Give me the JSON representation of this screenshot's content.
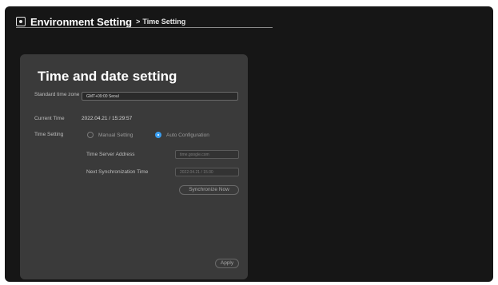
{
  "header": {
    "title": "Environment Setting",
    "separator": ">",
    "subtitle": "Time Setting",
    "icon": "settings-gear-icon"
  },
  "panel": {
    "title": "Time and date setting",
    "timezone": {
      "label": "Standard time zone",
      "value": "GMT+09:00 Seoul"
    },
    "current_time": {
      "label": "Current Time",
      "value": "2022.04.21 / 15:29:57"
    },
    "time_setting": {
      "label": "Time Setting",
      "options": [
        {
          "label": "Manual Setting",
          "selected": false
        },
        {
          "label": "Auto Configuration",
          "selected": true
        }
      ]
    },
    "time_server": {
      "label": "Time Server Address",
      "value": "time.google.com"
    },
    "next_sync": {
      "label": "Next Synchronization Time",
      "value": "2022.04.21 / 15:30"
    },
    "sync_button": "Synchronize Now",
    "apply_button": "Apply"
  },
  "colors": {
    "background": "#161616",
    "panel": "#3a3a3a",
    "accent": "#3a9ef0"
  }
}
